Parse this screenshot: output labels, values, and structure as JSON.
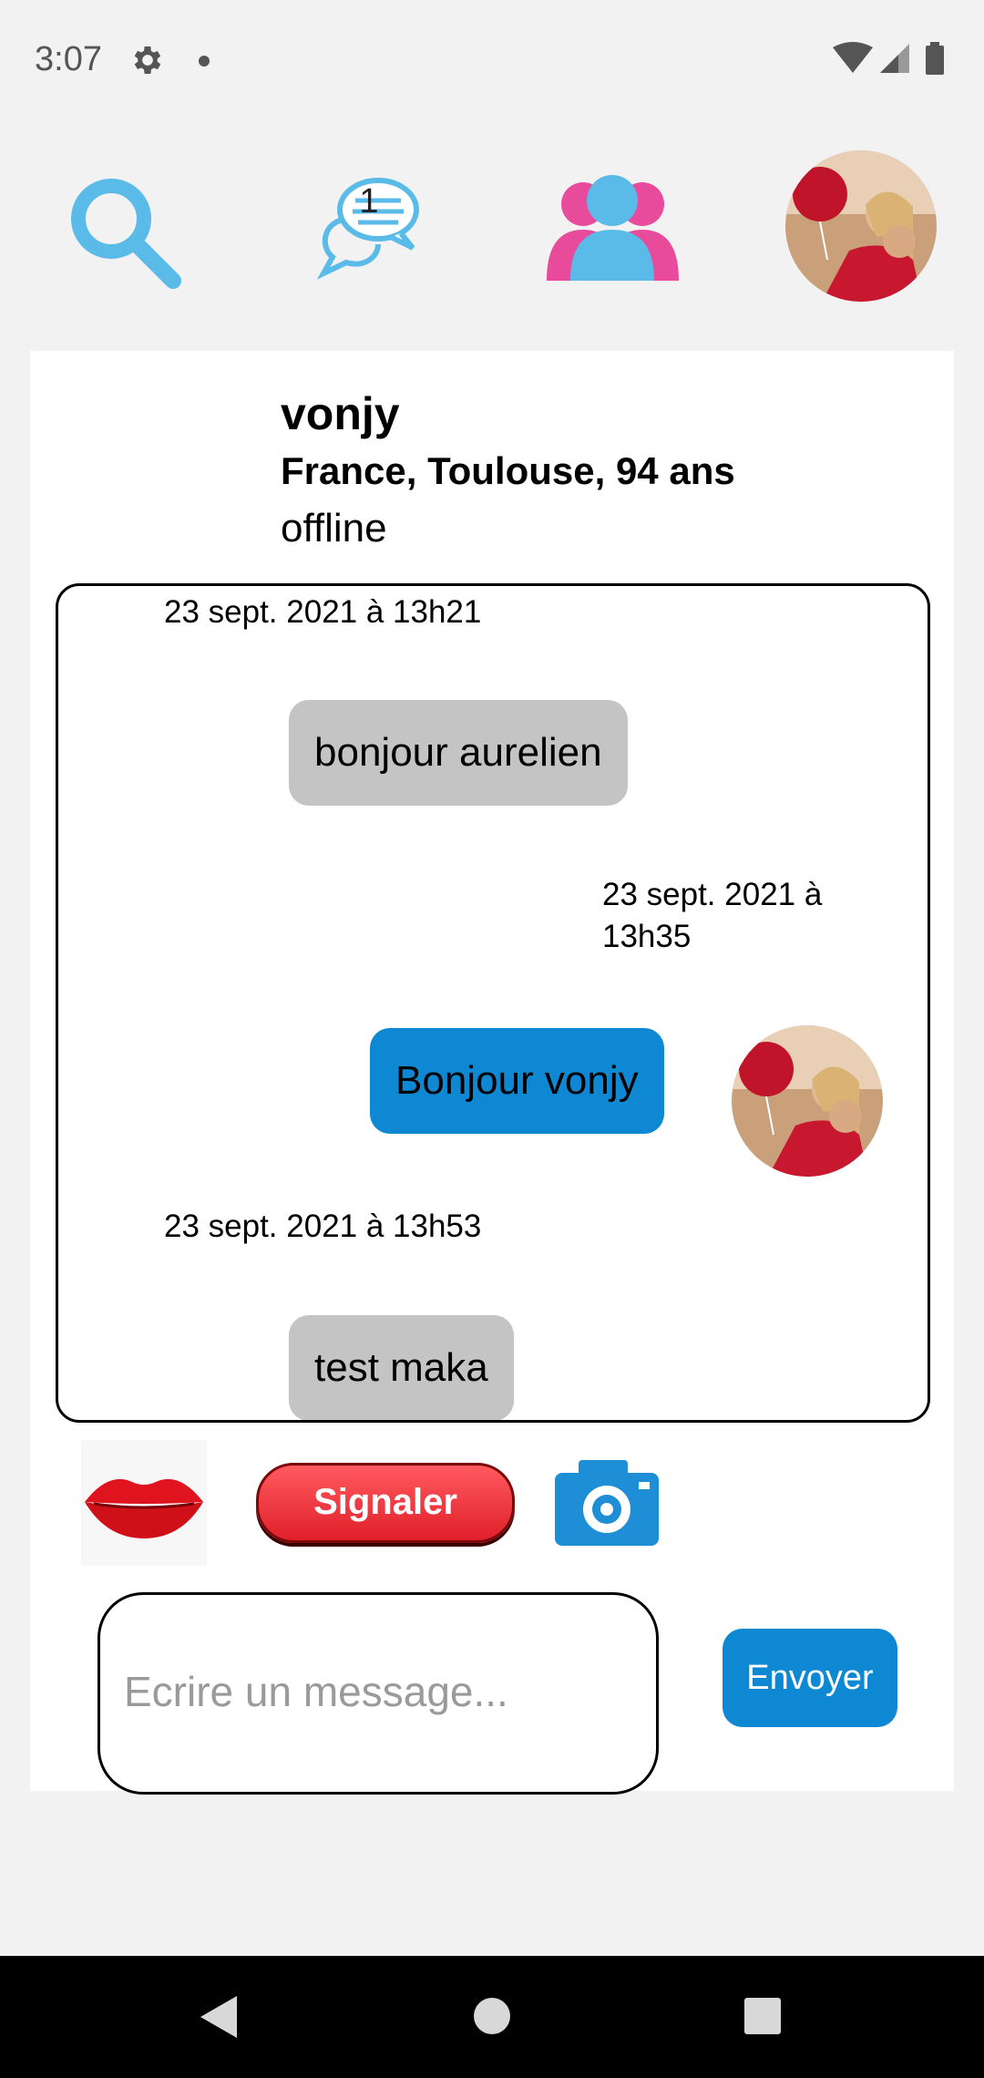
{
  "status_bar": {
    "time": "3:07"
  },
  "nav": {
    "chat_badge": "1"
  },
  "profile": {
    "name": "vonjy",
    "location": "France, Toulouse, 94 ans",
    "status": "offline"
  },
  "messages": [
    {
      "timestamp": "23 sept. 2021 à 13h21",
      "text": "bonjour aurelien",
      "direction": "incoming"
    },
    {
      "timestamp": "23 sept. 2021 à 13h35",
      "text": "Bonjour vonjy",
      "direction": "outgoing"
    },
    {
      "timestamp": "23 sept. 2021 à 13h53",
      "text": "test maka",
      "direction": "incoming"
    }
  ],
  "actions": {
    "report_label": "Signaler"
  },
  "composer": {
    "placeholder": "Ecrire un message...",
    "send_label": "Envoyer"
  },
  "colors": {
    "accent": "#0e88d3",
    "incoming_bubble": "#c4c4c4",
    "report": "#e0202a",
    "users_icon_pink": "#e84a9c"
  }
}
